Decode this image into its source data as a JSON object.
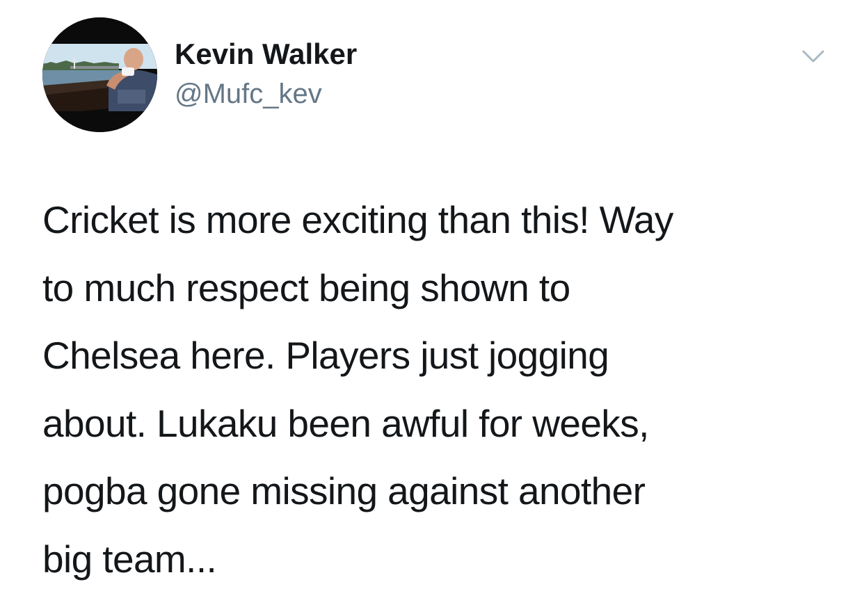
{
  "tweet": {
    "author": {
      "name": "Kevin Walker",
      "handle": "@Mufc_kev",
      "avatar_icon": "profile-photo-avatar"
    },
    "menu_icon": "chevron-down-icon",
    "text_lines": [
      "Cricket is more exciting than this! Way",
      "to much respect being shown to",
      "Chelsea here. Players just jogging",
      "about. Lukaku been awful for weeks,",
      "pogba gone missing against another",
      "big team..."
    ]
  },
  "colors": {
    "text_primary": "#14171a",
    "text_secondary": "#657786",
    "background": "#ffffff",
    "caret": "#aab8c2"
  }
}
